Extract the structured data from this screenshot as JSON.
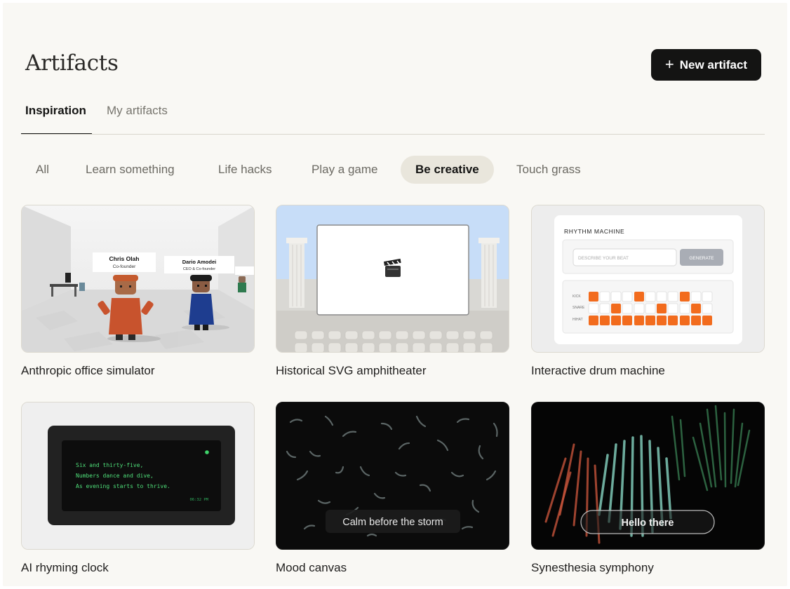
{
  "header": {
    "title": "Artifacts",
    "new_button_label": "New artifact",
    "new_button_icon": "plus-icon"
  },
  "tabs": [
    {
      "label": "Inspiration",
      "active": true
    },
    {
      "label": "My artifacts",
      "active": false
    }
  ],
  "categories": [
    {
      "label": "All",
      "active": false
    },
    {
      "label": "Learn something",
      "active": false
    },
    {
      "label": "Life hacks",
      "active": false
    },
    {
      "label": "Play a game",
      "active": false
    },
    {
      "label": "Be creative",
      "active": true
    },
    {
      "label": "Touch grass",
      "active": false
    }
  ],
  "cards": [
    {
      "title": "Anthropic office simulator",
      "preview": {
        "person1_name": "Chris Olah",
        "person1_role": "Co-founder",
        "person2_name": "Dario Amodei",
        "person2_role": "CEO & Co-founder"
      }
    },
    {
      "title": "Historical SVG amphitheater",
      "preview": {
        "icon": "clapperboard-icon"
      }
    },
    {
      "title": "Interactive drum machine",
      "preview": {
        "heading": "RHYTHM MACHINE",
        "input_placeholder": "DESCRIBE YOUR BEAT",
        "button_label": "GENERATE",
        "rows": [
          "KICK",
          "SNARE",
          "HIHAT"
        ]
      }
    },
    {
      "title": "AI rhyming clock",
      "preview": {
        "lines": [
          "Six and thirty-five,",
          "Numbers dance and dive,",
          "As evening starts to thrive."
        ],
        "time": "06:32 PM"
      }
    },
    {
      "title": "Mood canvas",
      "preview": {
        "caption": "Calm before the storm"
      }
    },
    {
      "title": "Synesthesia symphony",
      "preview": {
        "caption": "Hello there"
      }
    }
  ],
  "colors": {
    "accent_dark": "#141413",
    "chip_active_bg": "#e9e6dc",
    "beat_on": "#f26b1d",
    "clock_text": "#4fe07a",
    "page_bg": "#f9f8f4"
  }
}
